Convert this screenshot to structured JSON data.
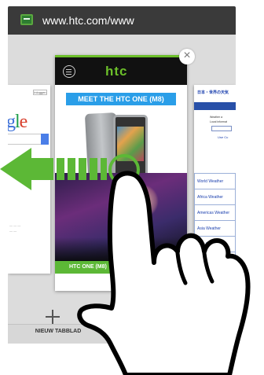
{
  "browser": {
    "url": "www.htc.com/www",
    "favicon": "page-icon",
    "new_tab_label": "NIEUW TABBLAD"
  },
  "tabs": {
    "left": {
      "signin_label": "Inloggen",
      "logo": "gle"
    },
    "center": {
      "logo": "htc",
      "banner": "MEET THE HTC ONE (M8)",
      "footer_label": "HTC ONE (M8)",
      "close_icon": "close-icon"
    },
    "right": {
      "header": "日本・世界の天気",
      "weather_lines": [
        "Weather a",
        "Local informat"
      ],
      "go_label": "Use Cu",
      "list": [
        "World Weather",
        "Africa Weather",
        "Americas Weather",
        "Asia Weather",
        "Asia Weather"
      ]
    }
  },
  "gesture": {
    "direction": "left",
    "arrow_color": "#5cb836"
  },
  "colors": {
    "htc_green": "#6cbf2a",
    "banner_blue": "#2a9ee8",
    "urlbar": "#3a3a3a"
  }
}
